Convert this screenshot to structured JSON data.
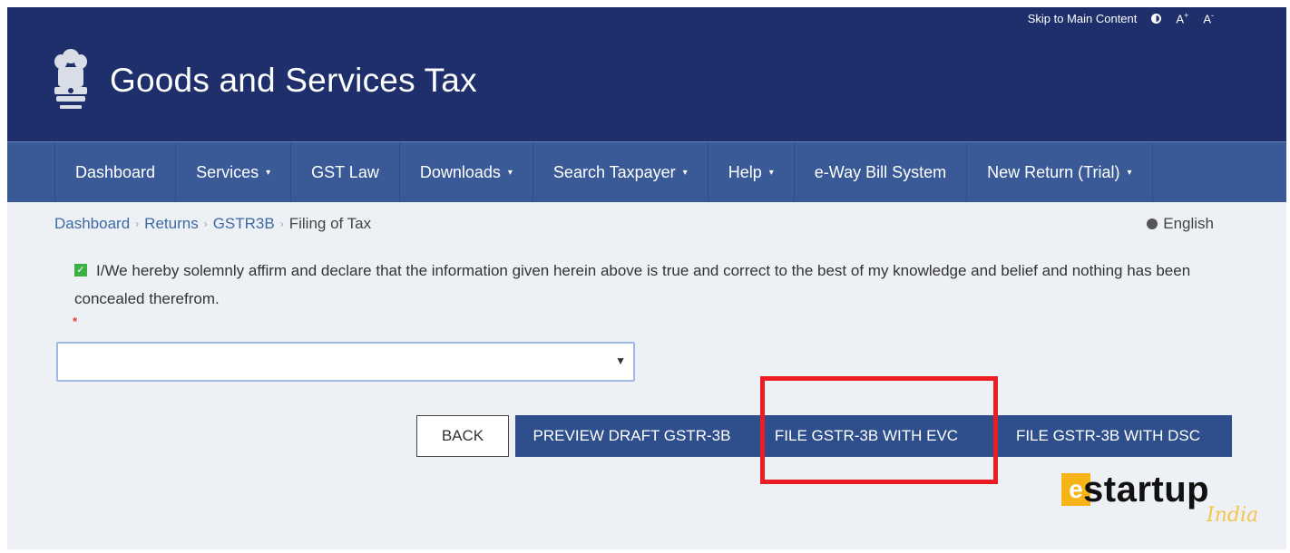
{
  "utility": {
    "skip_link": "Skip to Main Content",
    "font_increase": "A",
    "font_increase_sup": "+",
    "font_decrease": "A",
    "font_decrease_sup": "-"
  },
  "header": {
    "title": "Goods and Services Tax"
  },
  "nav": {
    "items": [
      {
        "label": "Dashboard",
        "dropdown": ""
      },
      {
        "label": "Services",
        "dropdown": "▾"
      },
      {
        "label": "GST Law",
        "dropdown": ""
      },
      {
        "label": "Downloads",
        "dropdown": "▾"
      },
      {
        "label": "Search Taxpayer",
        "dropdown": "▾"
      },
      {
        "label": "Help",
        "dropdown": "▾"
      },
      {
        "label": "e-Way Bill System",
        "dropdown": ""
      },
      {
        "label": "New Return (Trial)",
        "dropdown": "▾"
      }
    ]
  },
  "breadcrumb": {
    "items": [
      "Dashboard",
      "Returns",
      "GSTR3B"
    ],
    "current": "Filing of Tax"
  },
  "language": {
    "label": "English"
  },
  "declaration": {
    "text": "I/We hereby solemnly affirm and declare that the information given herein above is true and correct to the best of my knowledge and belief and nothing has been concealed therefrom.",
    "checked": true
  },
  "signatory": {
    "required_marker": "*",
    "selected_value": ""
  },
  "actions": {
    "back": "BACK",
    "preview": "PREVIEW DRAFT GSTR-3B",
    "file_evc": "FILE GSTR-3B WITH EVC",
    "file_dsc": "FILE GSTR-3B WITH DSC"
  },
  "watermark": {
    "mark": "e",
    "name": "startup",
    "sub": "India"
  },
  "colors": {
    "header_bg": "#1e2f6b",
    "nav_bg": "#3a5a97",
    "button_blue": "#2e4f8c",
    "highlight": "#ea1c24",
    "logo_accent": "#f6b416"
  }
}
